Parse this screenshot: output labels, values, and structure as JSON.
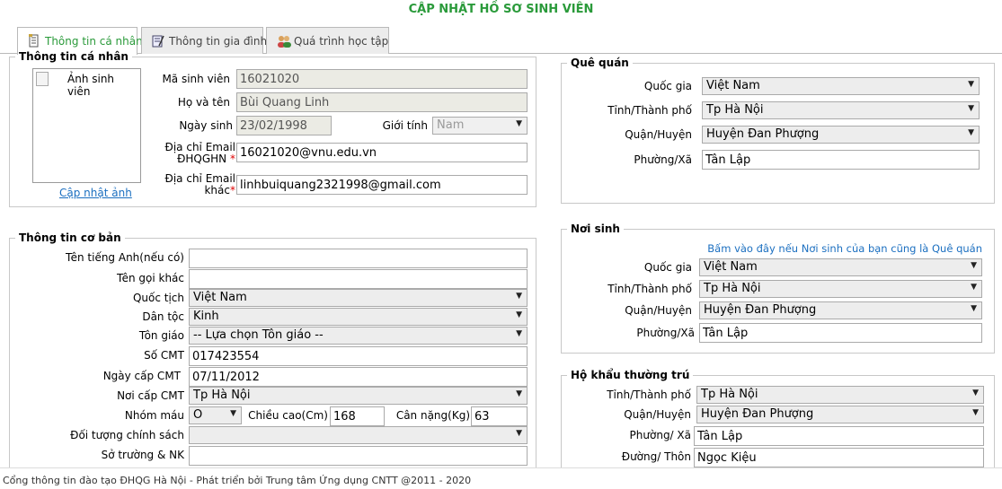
{
  "page_title": "CẬP NHẬT HỒ SƠ SINH VIÊN",
  "tabs": [
    {
      "label": "Thông tin cá nhân",
      "icon": "document-icon",
      "active": true
    },
    {
      "label": "Thông tin gia đình",
      "icon": "notepad-icon",
      "active": false
    },
    {
      "label": "Quá trình học tập",
      "icon": "users-icon",
      "active": false
    }
  ],
  "personal": {
    "legend": "Thông tin cá nhân",
    "photo_alt": "Ảnh sinh viên",
    "update_photo_link": "Cập nhật ảnh",
    "student_id_label": "Mã sinh viên",
    "student_id": "16021020",
    "full_name_label": "Họ và tên",
    "full_name": "Bùi Quang Linh",
    "dob_label": "Ngày sinh",
    "dob": "23/02/1998",
    "gender_label": "Giới tính",
    "gender": "Nam",
    "email_vnu_label_1": "Địa chỉ Email",
    "email_vnu_label_2": "ĐHQGHN",
    "email_vnu": "16021020@vnu.edu.vn",
    "email_other_label_1": "Địa chỉ Email",
    "email_other_label_2": "khác",
    "email_other": "linhbuiquang2321998@gmail.com",
    "required_mark": "*"
  },
  "basic": {
    "legend": "Thông tin cơ bản",
    "english_name_label": "Tên tiếng Anh(nếu có)",
    "english_name": "",
    "nickname_label": "Tên gọi khác",
    "nickname": "",
    "nationality_label": "Quốc tịch",
    "nationality": "Việt Nam",
    "ethnicity_label": "Dân tộc",
    "ethnicity": "Kinh",
    "religion_label": "Tôn giáo",
    "religion": "-- Lựa chọn Tôn giáo --",
    "id_number_label": "Số CMT",
    "id_number": "017423554",
    "id_date_label": "Ngày cấp CMT",
    "id_date": "07/11/2012",
    "id_place_label": "Nơi cấp CMT",
    "id_place": "Tp Hà Nội",
    "blood_label": "Nhóm máu",
    "blood": "O",
    "height_label": "Chiều cao(Cm)",
    "height": "168",
    "weight_label": "Cân nặng(Kg)",
    "weight": "63",
    "policy_label": "Đối tượng chính sách",
    "policy": "",
    "talent_label": "Sở trường & NK",
    "talent": ""
  },
  "hometown": {
    "legend": "Quê quán",
    "country_label": "Quốc gia",
    "country": "Việt Nam",
    "province_label": "Tỉnh/Thành phố",
    "province": "Tp Hà Nội",
    "district_label": "Quận/Huyện",
    "district": "Huyện Đan Phượng",
    "ward_label": "Phường/Xã",
    "ward": "Tân Lập"
  },
  "birthplace": {
    "legend": "Nơi sinh",
    "same_link": "Bấm vào đây nếu Nơi sinh của bạn cũng là Quê quán",
    "country_label": "Quốc gia",
    "country": "Việt Nam",
    "province_label": "Tỉnh/Thành phố",
    "province": "Tp Hà Nội",
    "district_label": "Quận/Huyện",
    "district": "Huyện Đan Phượng",
    "ward_label": "Phường/Xã",
    "ward": "Tân Lập"
  },
  "residence": {
    "legend": "Hộ khẩu thường trú",
    "province_label": "Tỉnh/Thành phố",
    "province": "Tp Hà Nội",
    "district_label": "Quận/Huyện",
    "district": "Huyện Đan Phượng",
    "ward_label": "Phường/ Xã",
    "ward": "Tân Lập",
    "street_label": "Đường/ Thôn",
    "street": "Ngọc Kiệu"
  },
  "footer": "Cổng thông tin đào tạo ĐHQG Hà Nội - Phát triển bởi Trung tâm Ứng dụng CNTT @2011 - 2020",
  "colors": {
    "title_green": "#2a9a3a",
    "link_blue": "#1b6fc0",
    "required_red": "#d00000"
  }
}
